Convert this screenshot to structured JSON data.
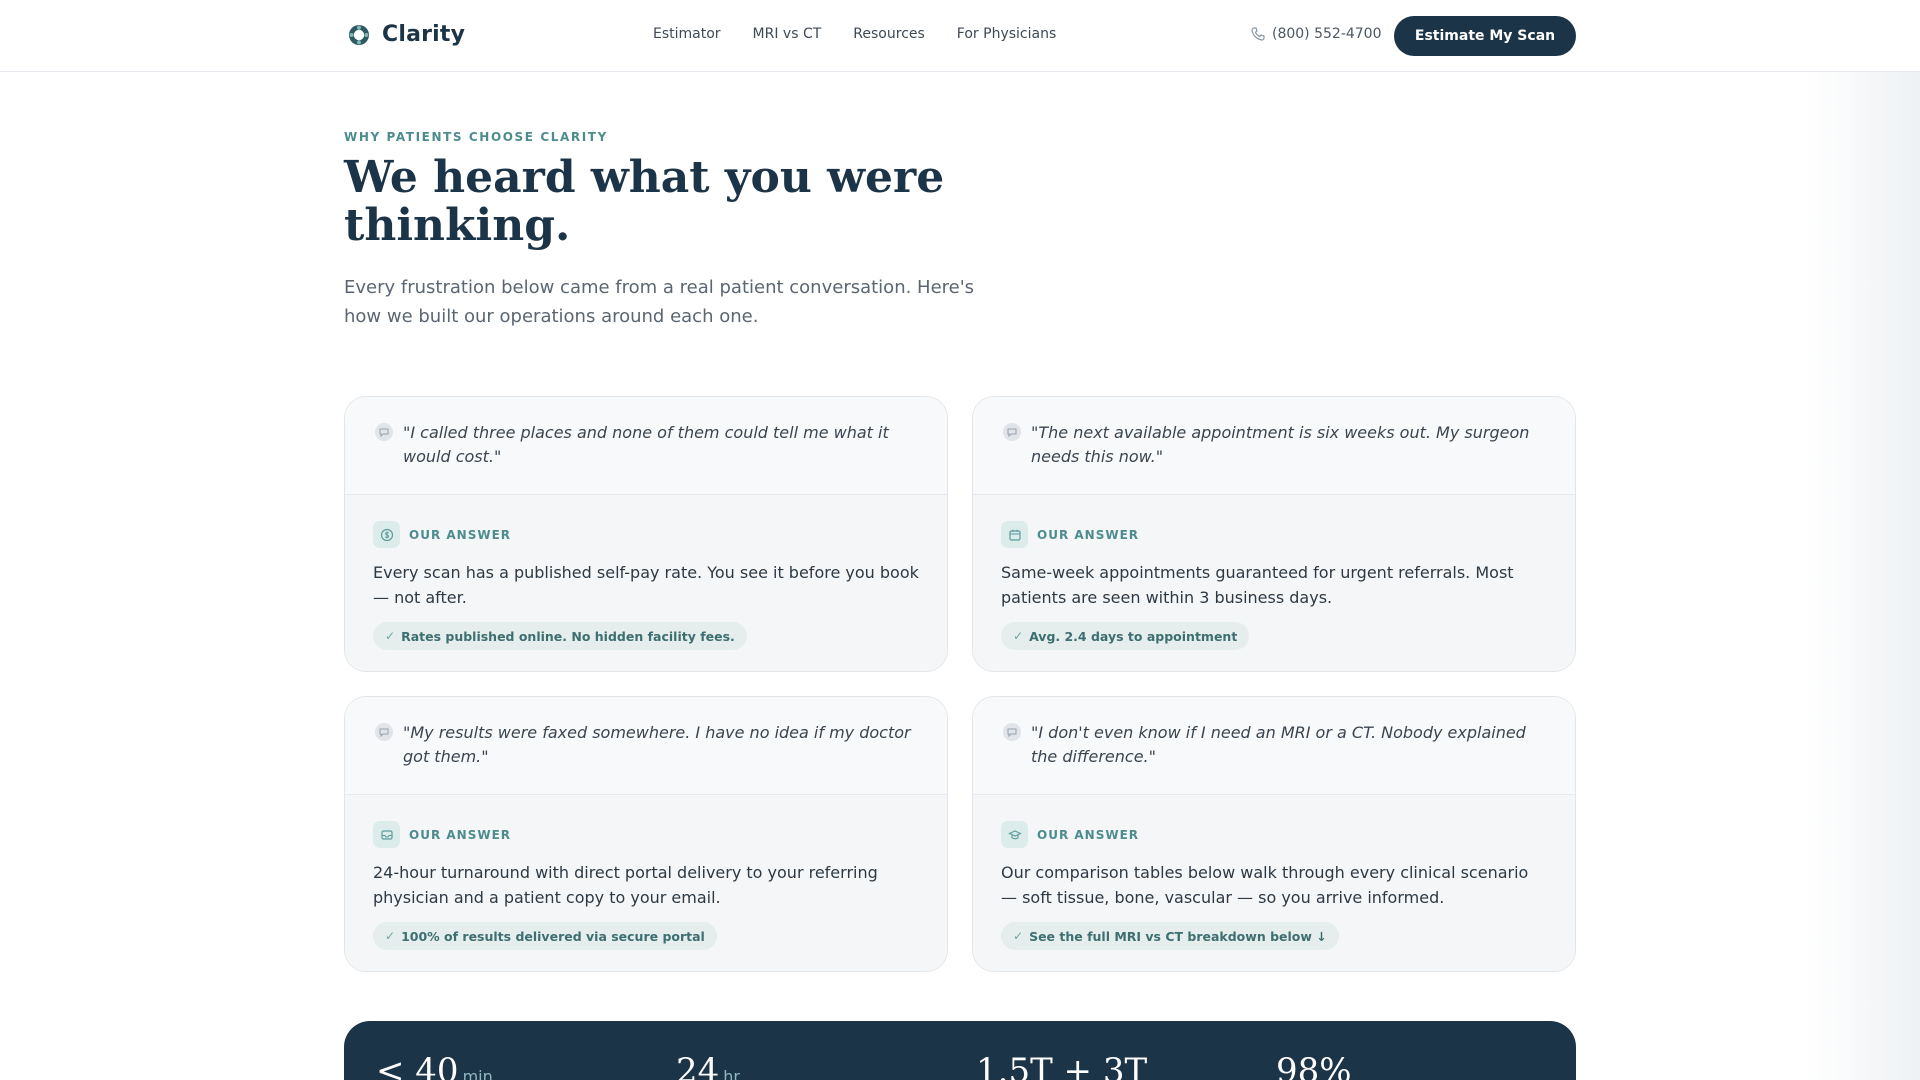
{
  "header": {
    "brand": "Clarity",
    "nav": [
      "Estimator",
      "MRI vs CT",
      "Resources",
      "For Physicians"
    ],
    "phone": "(800) 552-4700",
    "cta_label": "Estimate My Scan"
  },
  "hero": {
    "eyebrow": "WHY PATIENTS CHOOSE CLARITY",
    "title": "We heard what you were thinking.",
    "subtitle": "Every frustration below came from a real patient conversation. Here's how we built our operations around each one."
  },
  "cards": [
    {
      "quote": "\"I called three places and none of them could tell me what it would cost.\"",
      "answer_label": "OUR ANSWER",
      "answer_icon": "dollar-icon",
      "answer": "Every scan has a published self-pay rate. You see it before you book — not after.",
      "pill": "Rates published online. No hidden facility fees."
    },
    {
      "quote": "\"The next available appointment is six weeks out. My surgeon needs this now.\"",
      "answer_label": "OUR ANSWER",
      "answer_icon": "calendar-icon",
      "answer": "Same-week appointments guaranteed for urgent referrals. Most patients are seen within 3 business days.",
      "pill": "Avg. 2.4 days to appointment"
    },
    {
      "quote": "\"My results were faxed somewhere. I have no idea if my doctor got them.\"",
      "answer_label": "OUR ANSWER",
      "answer_icon": "inbox-icon",
      "answer": "24-hour turnaround with direct portal delivery to your referring physician and a patient copy to your email.",
      "pill": "100% of results delivered via secure portal"
    },
    {
      "quote": "\"I don't even know if I need an MRI or a CT. Nobody explained the difference.\"",
      "answer_label": "OUR ANSWER",
      "answer_icon": "graduation-cap-icon",
      "answer": "Our comparison tables below walk through every clinical scenario — soft tissue, bone, vascular — so you arrive informed.",
      "pill": "See the full MRI vs CT breakdown below ↓"
    }
  ],
  "stats": [
    {
      "value": "< 40",
      "unit": "min"
    },
    {
      "value": "24",
      "unit": "hr"
    },
    {
      "value": "1.5T + 3T",
      "unit": ""
    },
    {
      "value": "98%",
      "unit": ""
    }
  ],
  "colors": {
    "brand_navy": "#1c3447",
    "accent_teal": "#4d8c8e",
    "pill_bg": "#e5eeec"
  }
}
